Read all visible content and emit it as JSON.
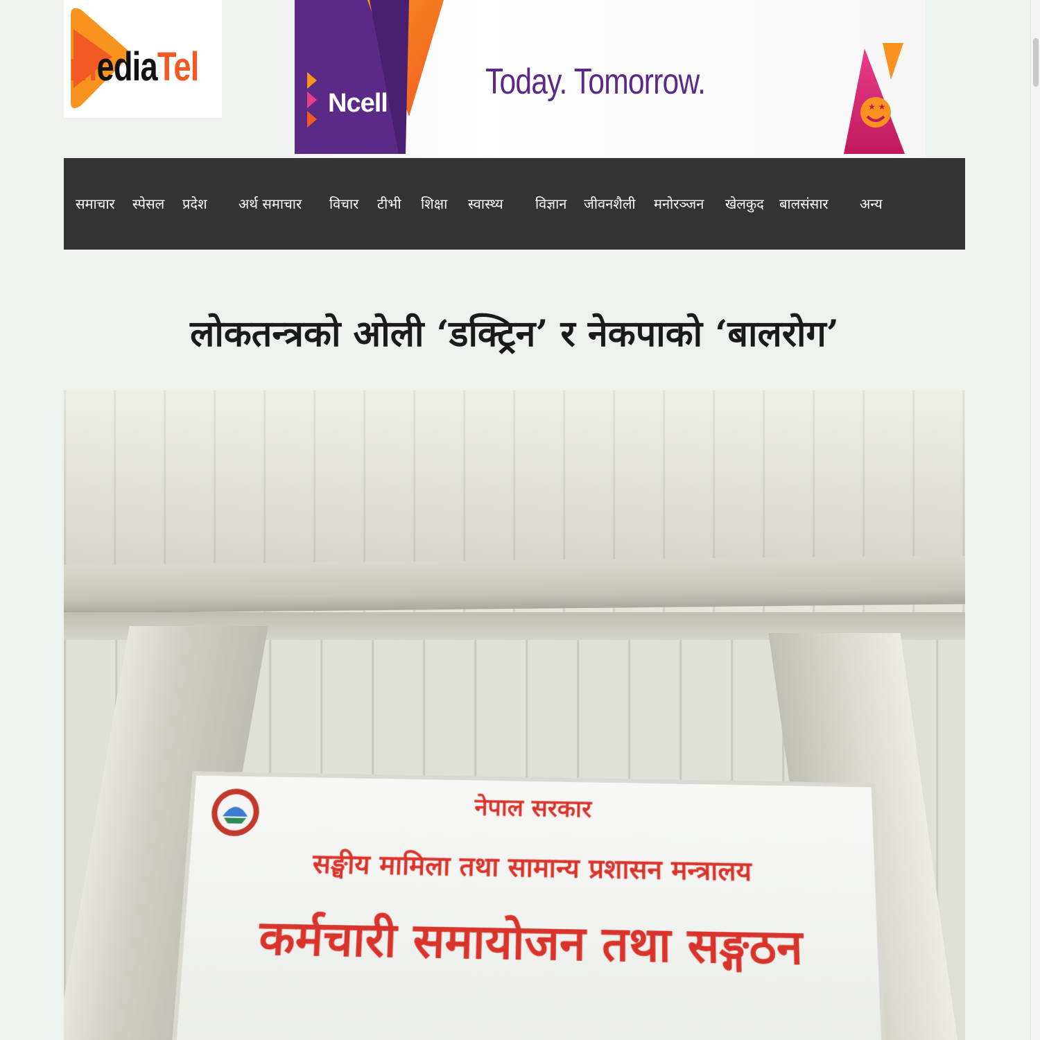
{
  "logo": {
    "part1": "m",
    "part2": "edia",
    "part3": "Tel"
  },
  "ad": {
    "brand": "Ncell",
    "tagline": "Today. Tomorrow."
  },
  "nav": {
    "items": [
      {
        "label": "समाचार"
      },
      {
        "label": "स्पेसल"
      },
      {
        "label": "प्रदेश"
      },
      {
        "label": "अर्थ समाचार"
      },
      {
        "label": "विचार"
      },
      {
        "label": "टीभी"
      },
      {
        "label": "शिक्षा"
      },
      {
        "label": "स्वास्थ्य"
      },
      {
        "label": "विज्ञान"
      },
      {
        "label": "जीवनशैली"
      },
      {
        "label": "मनोरञ्जन"
      },
      {
        "label": "खेलकुद"
      },
      {
        "label": "बालसंसार"
      },
      {
        "label": "अन्य"
      }
    ]
  },
  "article": {
    "headline": "लोकतन्त्रको ओली ‘डक्ट्रिन’ र नेकपाको ‘बालरोग’"
  },
  "photo": {
    "sign_line1": "नेपाल सरकार",
    "sign_line2": "सङ्घीय मामिला तथा सामान्य प्रशासन मन्त्रालय",
    "sign_line3": "कर्मचारी समायोजन तथा सङ्गठन"
  },
  "colors": {
    "page_bg": "#eef2ee",
    "nav_bg": "#333333",
    "logo_orange": "#f15a24",
    "ncell_purple": "#5b2a86",
    "sign_red": "#d9342b"
  }
}
